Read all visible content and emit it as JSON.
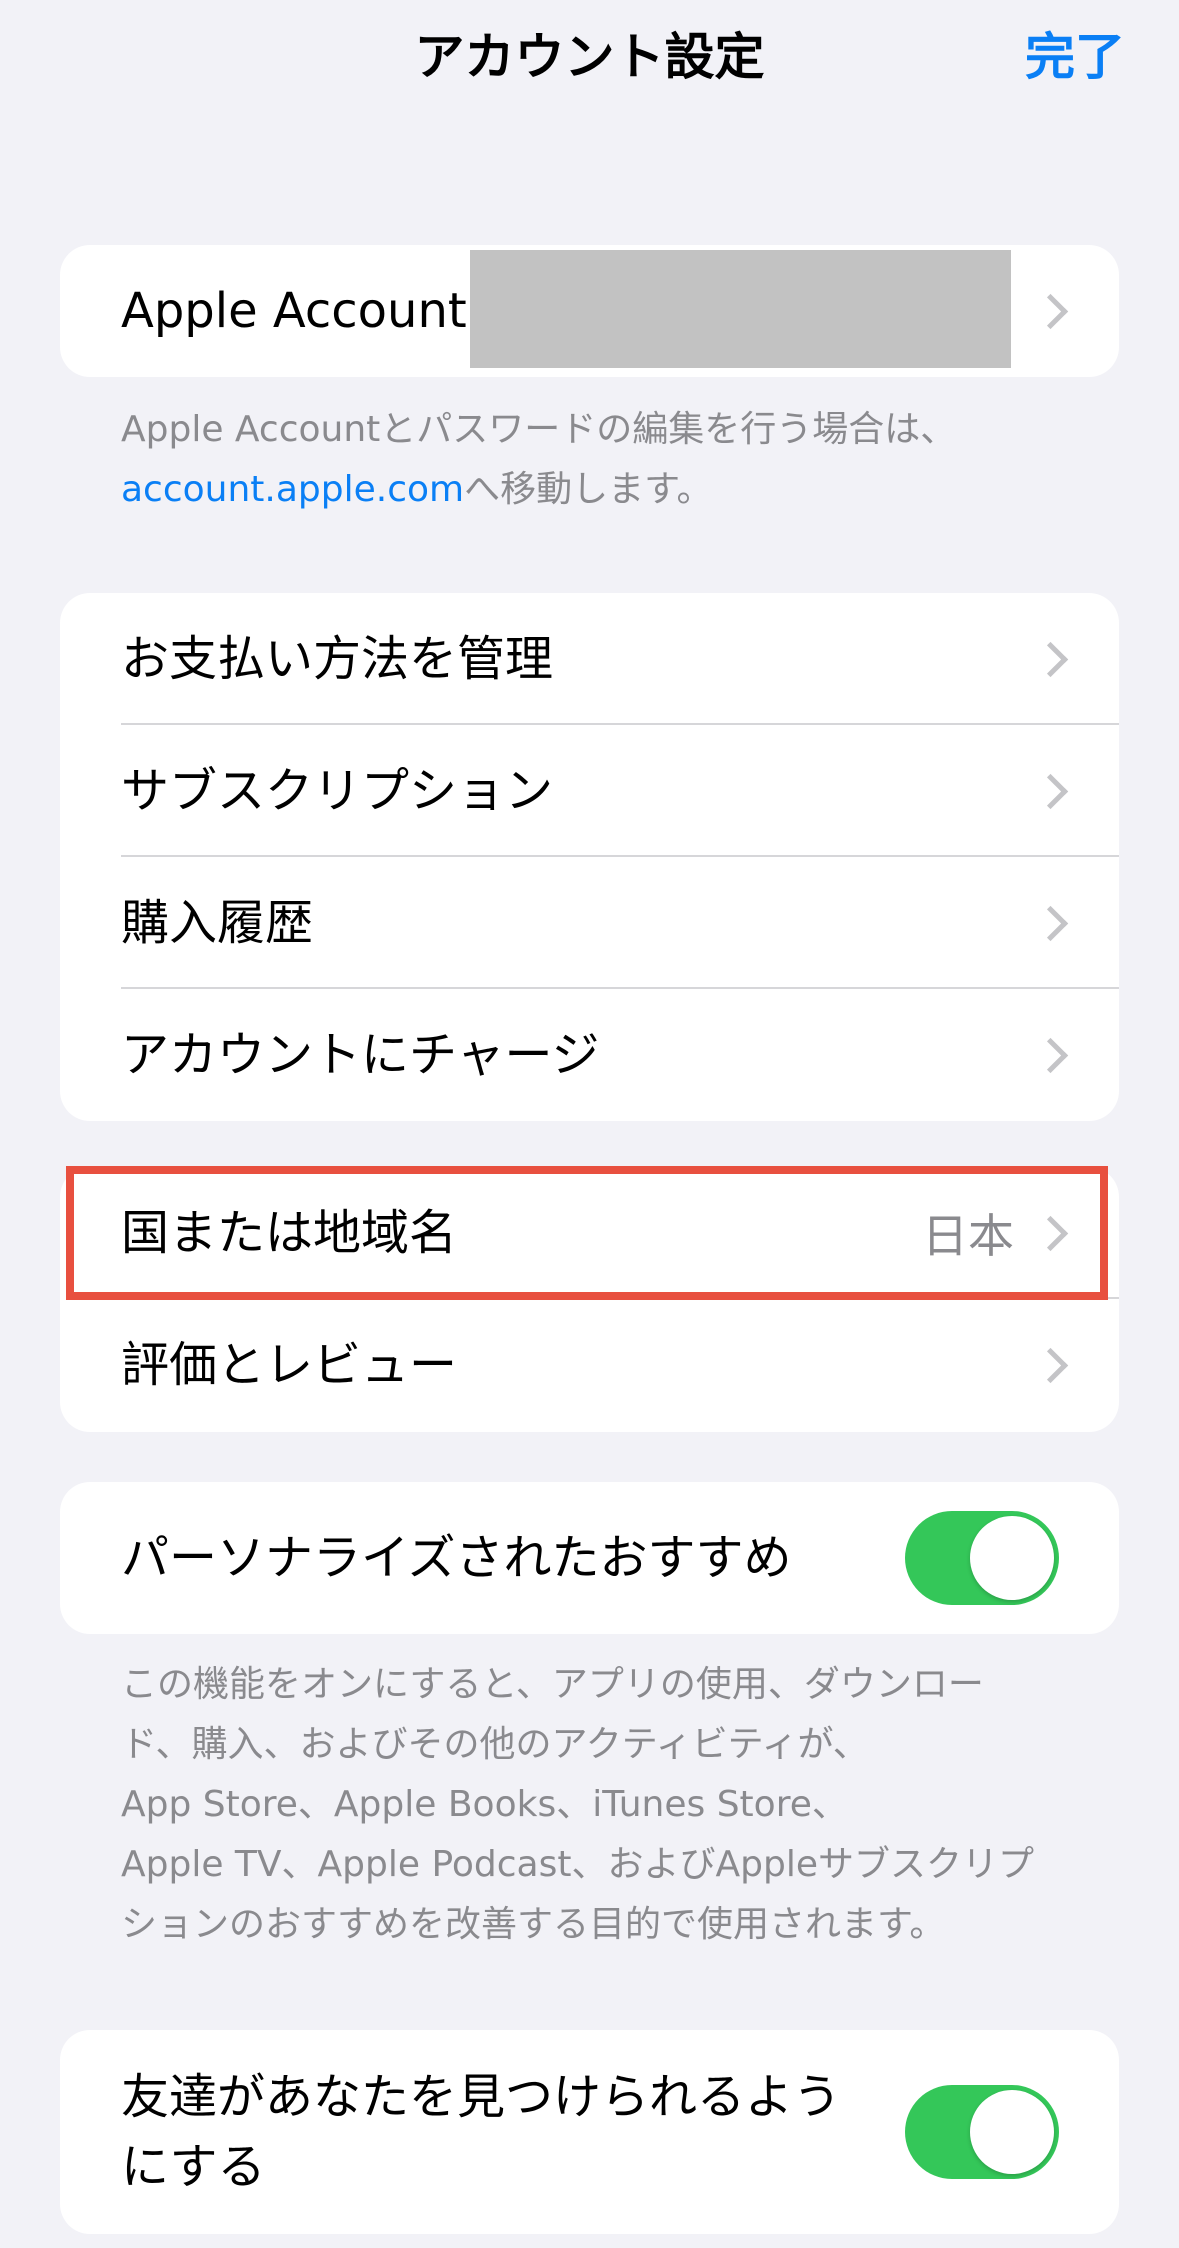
{
  "nav": {
    "title": "アカウント設定",
    "done_label": "完了"
  },
  "account": {
    "label": "Apple Account"
  },
  "account_footnote": {
    "text": "Apple Accountとパスワードの編集を行う場合は、",
    "link": "account.apple.com",
    "suffix": "へ移動します。"
  },
  "group2": {
    "items": [
      {
        "label": "お支払い方法を管理"
      },
      {
        "label": "サブスクリプション"
      },
      {
        "label": "購入履歴"
      },
      {
        "label": "アカウントにチャージ"
      }
    ]
  },
  "group3": {
    "country": {
      "label": "国または地域名",
      "value": "日本"
    },
    "ratings": {
      "label": "評価とレビュー"
    }
  },
  "personalized": {
    "label": "パーソナライズされたおすすめ",
    "enabled": true,
    "footnote_lines": [
      "この機能をオンにすると、アプリの使用、ダウンロー",
      "ド、購入、およびその他のアクティビティが、",
      "App Store、Apple Books、iTunes Store、",
      "Apple TV、Apple Podcast、およびAppleサブスクリプ",
      "ションのおすすめを改善する目的で使用されます。"
    ]
  },
  "friends": {
    "label_line1": "友達があなたを見つけられるよう",
    "label_line2": "にする",
    "enabled": true
  },
  "colors": {
    "accent": "#0a7ff5",
    "toggle_on": "#34c759",
    "highlight": "#e8503f"
  }
}
